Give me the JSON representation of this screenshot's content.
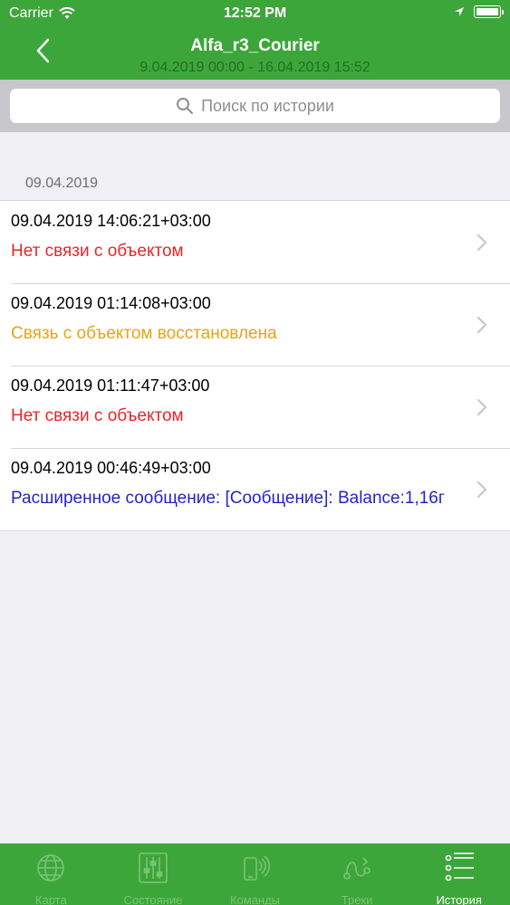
{
  "status_bar": {
    "carrier": "Carrier",
    "time": "12:52 PM"
  },
  "nav": {
    "title": "Alfa_r3_Courier",
    "subtitle": "9.04.2019 00:00 - 16.04.2019 15:52"
  },
  "search": {
    "placeholder": "Поиск по истории"
  },
  "section": {
    "header": "09.04.2019"
  },
  "events": [
    {
      "time": "09.04.2019 14:06:21+03:00",
      "message": "Нет связи с объектом",
      "color": "#e8262a"
    },
    {
      "time": "09.04.2019 01:14:08+03:00",
      "message": "Связь с объектом восстановлена",
      "color": "#e8a317"
    },
    {
      "time": "09.04.2019 01:11:47+03:00",
      "message": "Нет связи с объектом",
      "color": "#e8262a"
    },
    {
      "time": "09.04.2019 00:46:49+03:00",
      "message": "Расширенное сообщение: [Сообщение]: Balance:1,16г",
      "color": "#2424c8"
    }
  ],
  "tabs": [
    {
      "label": "Карта",
      "icon": "globe-icon",
      "active": false
    },
    {
      "label": "Состояние",
      "icon": "sliders-icon",
      "active": false
    },
    {
      "label": "Команды",
      "icon": "phone-signal-icon",
      "active": false
    },
    {
      "label": "Треки",
      "icon": "track-route-icon",
      "active": false
    },
    {
      "label": "История",
      "icon": "list-icon",
      "active": true
    }
  ],
  "colors": {
    "accent": "#3da63a",
    "tab_inactive": "#7bc476",
    "tab_active": "#ffffff"
  }
}
